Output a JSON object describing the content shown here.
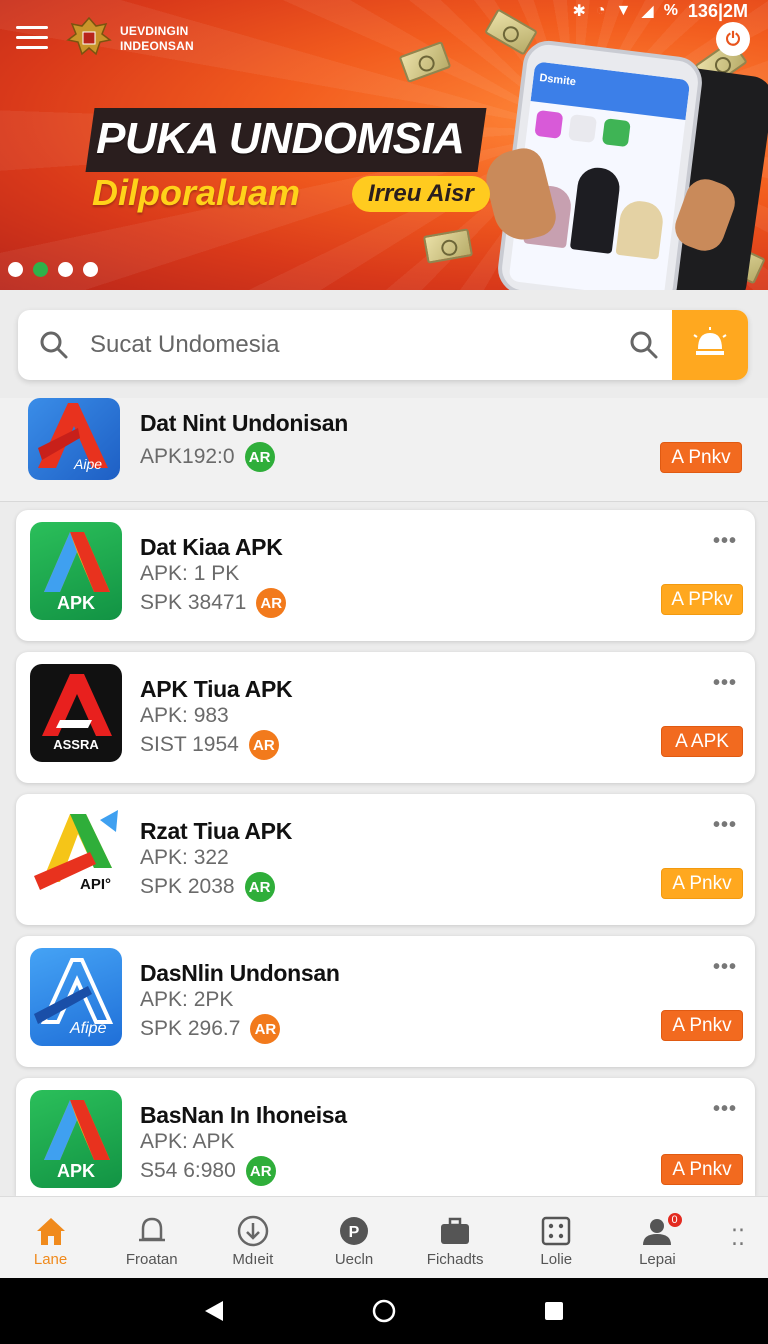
{
  "status_bar": {
    "time": "136|2M"
  },
  "banner": {
    "brand_line1": "UEVDINGIN",
    "brand_line2": "INDEONSAN",
    "headline": "PUKA UNDOMSIA",
    "subline": "Dilporaluam",
    "pill": "Irreu Aisr",
    "phone_title": "Dsmite",
    "slides": 4,
    "active_slide": 2
  },
  "search": {
    "placeholder": "Sucat Undomesia"
  },
  "apps": [
    {
      "name": "Dat Nint Undonisan",
      "line2": "APK192:0",
      "line3": "",
      "badge": "AR",
      "badge_color": "#2fae3a",
      "button": "A Pnkv",
      "icon_label": "Aipe"
    },
    {
      "name": "Dat Kiaa APK",
      "line2": "APK: 1 PK",
      "line3": "SPK 38471",
      "badge": "AR",
      "badge_color": "#f27a1c",
      "button": "A PPkv",
      "icon_label": "APK"
    },
    {
      "name": "APK Tiua APK",
      "line2": "APK: 983",
      "line3": "SIST 1954",
      "badge": "AR",
      "badge_color": "#f27a1c",
      "button": "A APK",
      "icon_label": "ASSRA"
    },
    {
      "name": "Rzat Tiua APK",
      "line2": "APK: 322",
      "line3": "SPK 2038",
      "badge": "AR",
      "badge_color": "#2fae3a",
      "button": "A Pnkv",
      "icon_label": "API°"
    },
    {
      "name": "DasNlin Undonsan",
      "line2": "APK: 2PK",
      "line3": "SPK 296.7",
      "badge": "AR",
      "badge_color": "#f27a1c",
      "button": "A Pnkv",
      "icon_label": "Afipe"
    },
    {
      "name": "BasNan In Ihoneisa",
      "line2": "APK: APK",
      "line3": "S54 6:980",
      "badge": "AR",
      "badge_color": "#2fae3a",
      "button": "A Pnkv",
      "icon_label": "APK"
    }
  ],
  "nav": {
    "items": [
      {
        "label": "Lane",
        "icon": "home-icon"
      },
      {
        "label": "Froatan",
        "icon": "bell-icon"
      },
      {
        "label": "Mdıeit",
        "icon": "download-icon"
      },
      {
        "label": "Uecln",
        "icon": "profile-p-icon"
      },
      {
        "label": "Fichadts",
        "icon": "briefcase-icon"
      },
      {
        "label": "Lolie",
        "icon": "grid-icon"
      },
      {
        "label": "Lepai",
        "icon": "user-icon"
      }
    ],
    "notification_count": "0"
  },
  "colors": {
    "accent": "#f26a1f",
    "active_nav": "#f08a1c",
    "search_action": "#ffa81f"
  }
}
